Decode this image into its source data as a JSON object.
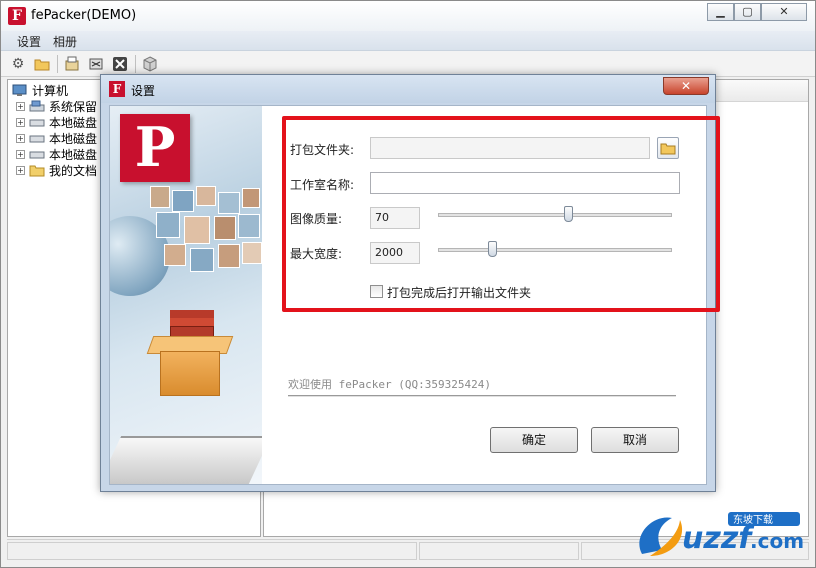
{
  "app": {
    "title": "fePacker(DEMO)",
    "icon": "fepacker-logo-icon"
  },
  "menu": [
    "设置",
    "相册"
  ],
  "toolbar": {
    "icons": [
      "gear-icon",
      "open-folder-icon",
      "pack-icon",
      "export-icon",
      "delete-icon",
      "box-icon"
    ]
  },
  "tree": {
    "items": [
      {
        "label": "计算机",
        "icon": "computer-icon"
      },
      {
        "label": "系统保留",
        "icon": "system-drive-icon"
      },
      {
        "label": "本地磁盘",
        "icon": "drive-icon"
      },
      {
        "label": "本地磁盘",
        "icon": "drive-icon"
      },
      {
        "label": "本地磁盘",
        "icon": "drive-icon"
      },
      {
        "label": "我的文档",
        "icon": "documents-folder-icon"
      }
    ]
  },
  "dialog": {
    "title": "设置",
    "fields": {
      "package_folder_label": "打包文件夹:",
      "package_folder_value": "",
      "studio_name_label": "工作室名称:",
      "studio_name_value": "",
      "image_quality_label": "图像质量:",
      "image_quality_value": "70",
      "image_quality_level": 0.56,
      "max_width_label": "最大宽度:",
      "max_width_value": "2000",
      "max_width_level": 0.22,
      "open_folder_checkbox_label": "打包完成后打开输出文件夹",
      "open_folder_checked": false
    },
    "welcome_text": "欢迎使用 fePacker (QQ:359325424)",
    "ok_label": "确定",
    "cancel_label": "取消",
    "close_glyph": "✕"
  },
  "colors": {
    "brand_red": "#c8102e",
    "highlight_red": "#e3121b",
    "dialog_frame": "#c7d6e8"
  },
  "watermark": {
    "brand": "uzzf.com",
    "tagline": "东坡下载"
  }
}
